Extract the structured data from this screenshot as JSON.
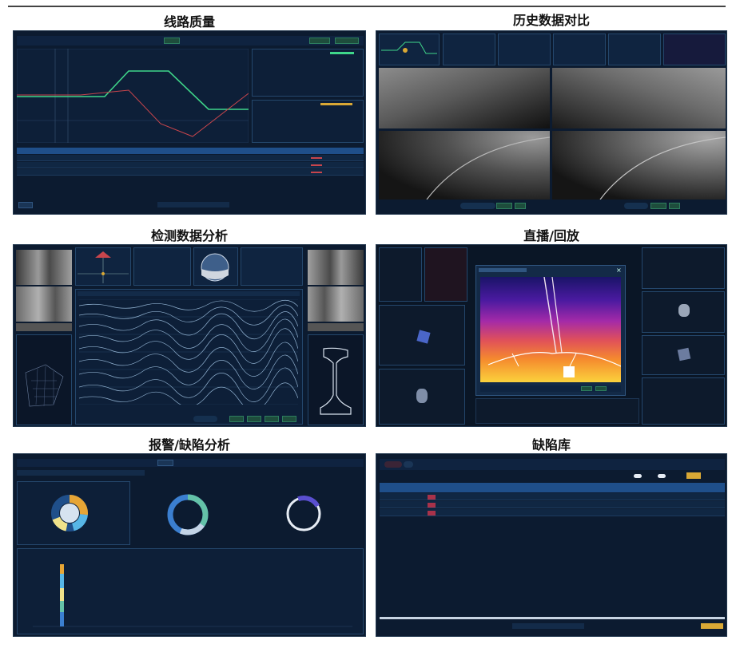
{
  "titles": {
    "p1": "线路质量",
    "p2": "历史数据对比",
    "p3": "检测数据分析",
    "p4": "直播/回放",
    "p5": "报警/缺陷分析",
    "p6": "缺陷库"
  },
  "colors": {
    "panel_bg": "#0c1b30",
    "line_green": "#3fd68a",
    "line_red": "#c8454c",
    "table_header": "#1f4f8a",
    "accent_gold": "#d9a835"
  },
  "icons": [
    "play-icon",
    "prev-icon",
    "next-icon",
    "close-icon",
    "compass-icon",
    "rail-profile-icon"
  ]
}
